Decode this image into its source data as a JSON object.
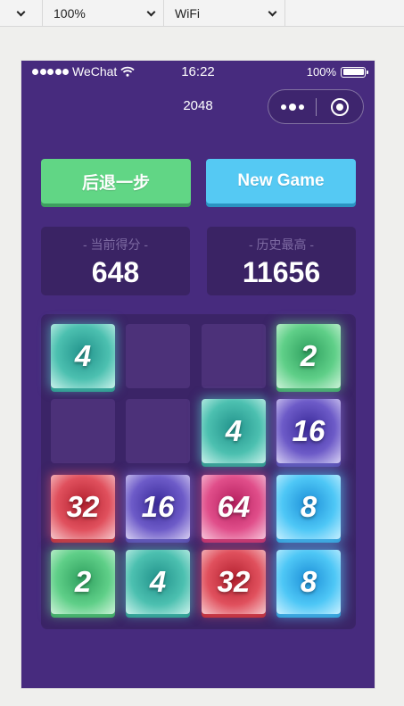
{
  "toolbar": {
    "zoom": "100%",
    "network": "WiFi"
  },
  "status_bar": {
    "carrier": "WeChat",
    "time": "16:22",
    "battery": "100%"
  },
  "nav": {
    "title": "2048"
  },
  "buttons": {
    "undo_label": "后退一步",
    "new_game_label": "New Game"
  },
  "scores": {
    "current_label": "- 当前得分 -",
    "current_value": "648",
    "best_label": "- 历史最高 -",
    "best_value": "11656"
  },
  "board": {
    "cells": [
      [
        "4",
        "",
        "",
        "2"
      ],
      [
        "",
        "",
        "4",
        "16"
      ],
      [
        "32",
        "16",
        "64",
        "8"
      ],
      [
        "2",
        "4",
        "32",
        "8"
      ]
    ]
  },
  "colors": {
    "background": "#472b7e",
    "panel": "#3a2364",
    "undo_button": "#61d685",
    "new_game_button": "#55c9f3"
  }
}
